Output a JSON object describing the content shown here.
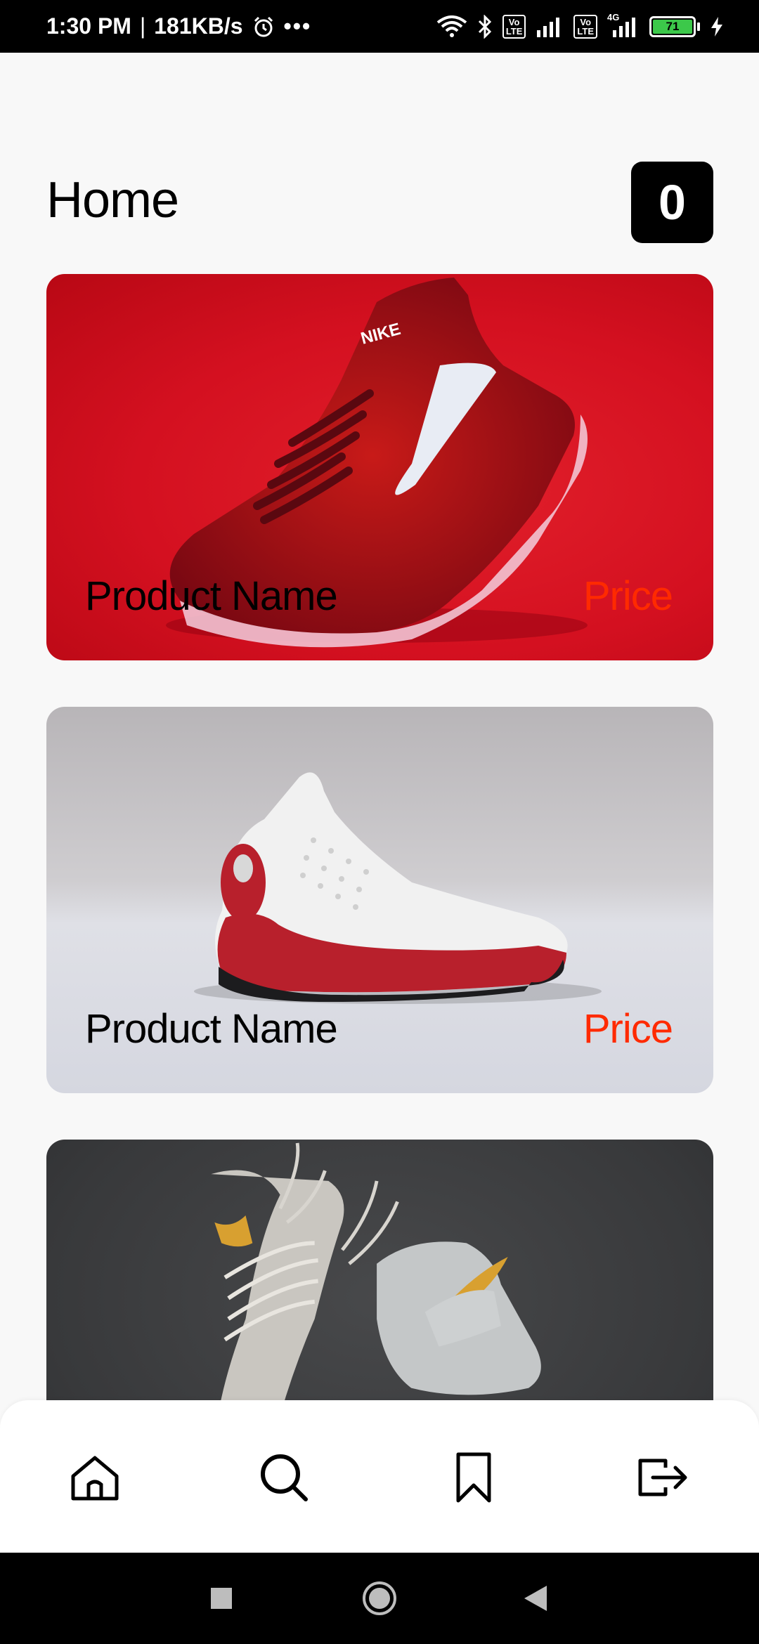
{
  "status_bar": {
    "time": "1:30 PM",
    "separator": "|",
    "speed": "181KB/s",
    "more": "•••",
    "volte1": "Vo\nLTE",
    "volte2": "Vo\nLTE",
    "network": "4G",
    "battery": "71",
    "icons": [
      "alarm-icon",
      "wifi-icon",
      "bluetooth-icon",
      "signal-icon",
      "charging-icon"
    ]
  },
  "header": {
    "title": "Home",
    "cart_count": "0"
  },
  "products": [
    {
      "name": "Product Name",
      "price": "Price",
      "image": "red-sneaker"
    },
    {
      "name": "Product Name",
      "price": "Price",
      "image": "white-red-basketball-shoe"
    },
    {
      "name": "",
      "price": "",
      "image": "grey-high-top-sneakers"
    }
  ],
  "bottom_nav": {
    "items": [
      "home-icon",
      "search-icon",
      "bookmark-icon",
      "logout-icon"
    ]
  },
  "system_nav": {
    "items": [
      "recents-icon",
      "home-circle-icon",
      "back-icon"
    ]
  },
  "colors": {
    "price": "#ff2a00",
    "badge_bg": "#000000",
    "background": "#f8f8f8"
  }
}
